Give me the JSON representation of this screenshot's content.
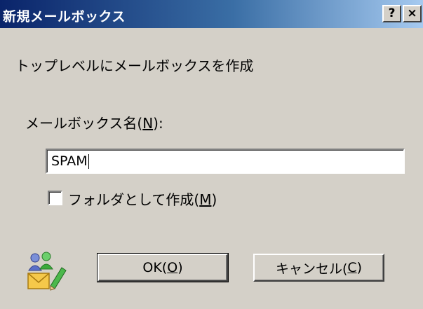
{
  "window": {
    "title": "新規メールボックス",
    "help_button": "?",
    "close_button": "×"
  },
  "dialog": {
    "heading": "トップレベルにメールボックスを作成",
    "name_label_prefix": "メールボックス名(",
    "name_label_key": "N",
    "name_label_suffix": "):",
    "name_value": "SPAM",
    "checkbox_checked": false,
    "checkbox_label_prefix": "フォルダとして作成(",
    "checkbox_label_key": "M",
    "checkbox_label_suffix": ")"
  },
  "buttons": {
    "ok_prefix": "OK(",
    "ok_key": "O",
    "ok_suffix": ")",
    "cancel_prefix": "キャンセル(",
    "cancel_key": "C",
    "cancel_suffix": ")"
  },
  "icons": {
    "dialog_icon": "mail-users-icon"
  },
  "colors": {
    "titlebar_start": "#0a246a",
    "titlebar_end": "#a6caf0",
    "face": "#d4d0c8"
  }
}
